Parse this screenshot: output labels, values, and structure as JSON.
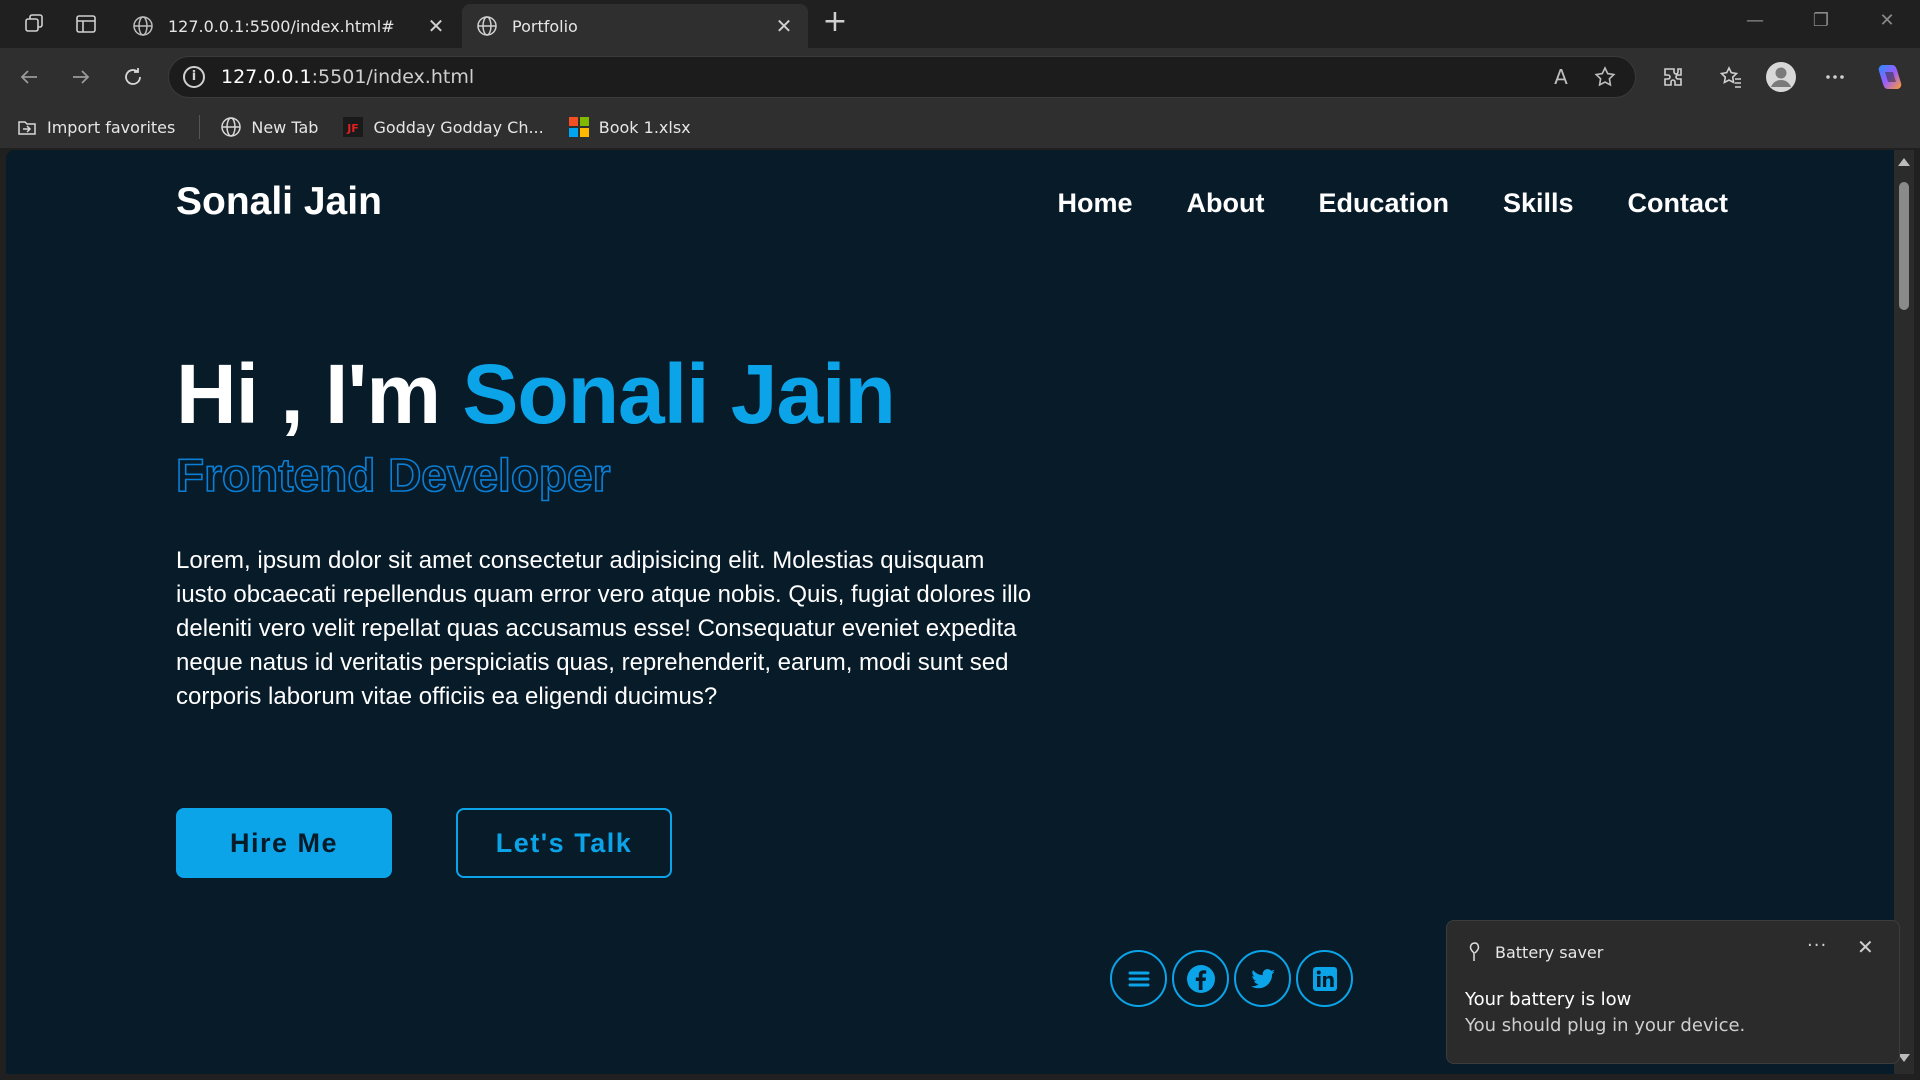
{
  "browser": {
    "tabs": [
      {
        "title": "127.0.0.1:5500/index.html#",
        "active": false
      },
      {
        "title": "Portfolio",
        "active": true
      }
    ],
    "close_glyph": "✕",
    "new_tab_glyph": "+",
    "url_host": "127.0.0.1",
    "url_rest": ":5501/index.html",
    "info_glyph": "i",
    "read_aloud_glyph": "A",
    "bookmarks": [
      {
        "label": "Import favorites",
        "icon": "import-icon"
      },
      {
        "label": "New Tab",
        "icon": "globe-icon"
      },
      {
        "label": "Godday Godday Ch...",
        "icon": "jf-icon"
      },
      {
        "label": "Book 1.xlsx",
        "icon": "microsoft-icon"
      }
    ],
    "jf_logo_text": "JF",
    "window_controls": {
      "minimize": "—",
      "restore": "❐",
      "close": "✕"
    }
  },
  "page": {
    "logo": "Sonali Jain",
    "nav": [
      "Home",
      "About",
      "Education",
      "Skills",
      "Contact"
    ],
    "hero": {
      "greeting": "Hi , I'm ",
      "name": "Sonali Jain",
      "role": "Frontend Developer",
      "description": "Lorem, ipsum dolor sit amet consectetur adipisicing elit. Molestias quisquam iusto obcaecati repellendus quam error vero atque nobis. Quis, fugiat dolores illo deleniti vero velit repellat quas accusamus esse! Consequatur eveniet expedita neque natus id veritatis perspiciatis quas, reprehenderit, earum, modi sunt sed corporis laborum vitae officiis ea eligendi ducimus?"
    },
    "buttons": {
      "hire": "Hire Me",
      "talk": "Let's Talk"
    },
    "socials": [
      "menu-icon",
      "facebook-icon",
      "twitter-icon",
      "linkedin-icon"
    ],
    "accent_color": "#0ba4e8",
    "background_color": "#081b29"
  },
  "toast": {
    "app": "Battery saver",
    "title": "Your battery is low",
    "body": "You should plug in your device.",
    "more": "···",
    "close": "✕"
  }
}
